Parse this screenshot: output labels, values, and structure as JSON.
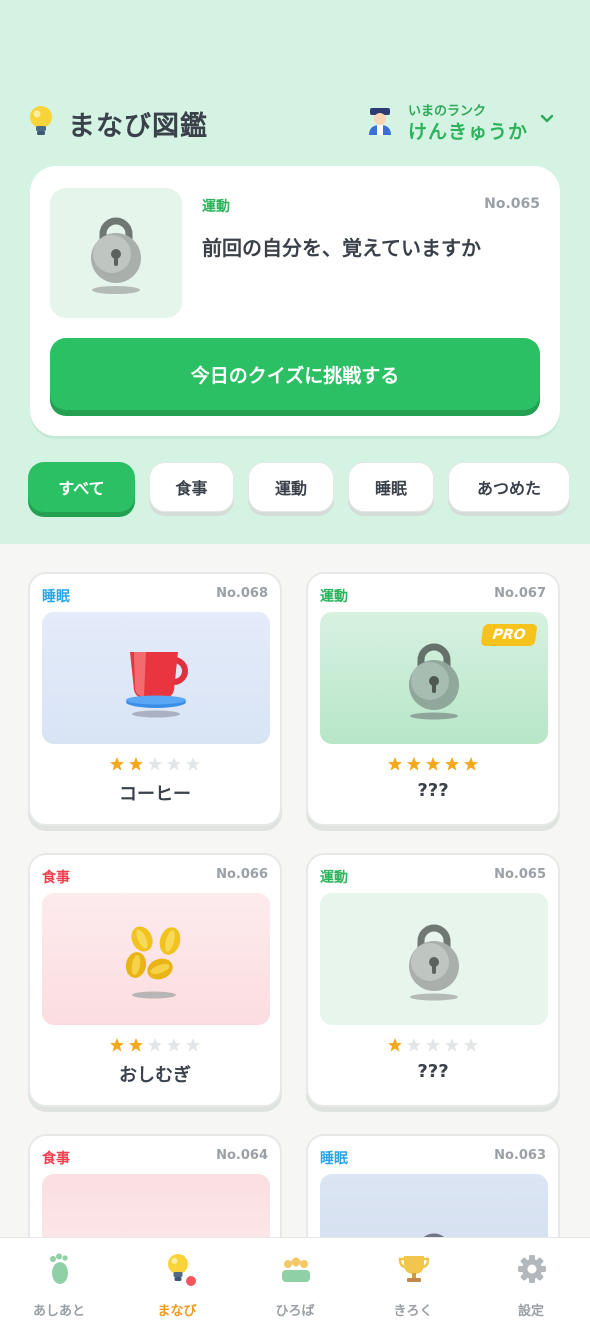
{
  "header": {
    "title": "まなび図鑑",
    "logo_icon": "lightbulb-icon",
    "rank_caption": "いまのランク",
    "rank_value": "けんきゅうか",
    "rank_icon": "scientist-avatar-icon",
    "rank_toggle_icon": "chevron-down-icon"
  },
  "featured": {
    "category": "運動",
    "number": "No.065",
    "title": "前回の自分を、覚えていますか",
    "thumb_icon": "lock-icon",
    "cta_label": "今日のクイズに挑戦する"
  },
  "filters": [
    "すべて",
    "食事",
    "運動",
    "睡眠",
    "あつめた"
  ],
  "active_filter": "すべて",
  "cards": [
    {
      "category": "睡眠",
      "category_color": "#2aa5e8",
      "number": "No.068",
      "name": "コーヒー",
      "rating": 2,
      "icon": "coffee-cup-icon",
      "pro": false,
      "locked": false
    },
    {
      "category": "運動",
      "category_color": "#2cb35c",
      "number": "No.067",
      "name": "???",
      "rating": 5,
      "icon": "lock-icon",
      "pro": true,
      "pro_label": "PRO",
      "locked": true
    },
    {
      "category": "食事",
      "category_color": "#f0404f",
      "number": "No.066",
      "name": "おしむぎ",
      "rating": 2,
      "icon": "barley-grains-icon",
      "pro": false,
      "locked": false
    },
    {
      "category": "運動",
      "category_color": "#2cb35c",
      "number": "No.065",
      "name": "???",
      "rating": 1,
      "icon": "lock-icon",
      "pro": false,
      "locked": true
    },
    {
      "category": "食事",
      "category_color": "#f0404f",
      "number": "No.064",
      "name": "",
      "rating": 0,
      "icon": "food-icon",
      "pro": false,
      "locked": false
    },
    {
      "category": "睡眠",
      "category_color": "#2aa5e8",
      "number": "No.063",
      "name": "",
      "rating": 0,
      "icon": "lock-icon",
      "pro": false,
      "locked": true
    }
  ],
  "nav": [
    {
      "label": "あしあと",
      "icon": "footprint-icon",
      "active": false
    },
    {
      "label": "まなび",
      "icon": "lightbulb-icon",
      "active": true
    },
    {
      "label": "ひろば",
      "icon": "people-icon",
      "active": false
    },
    {
      "label": "きろく",
      "icon": "trophy-icon",
      "active": false
    },
    {
      "label": "設定",
      "icon": "gear-icon",
      "active": false
    }
  ],
  "colors": {
    "primary": "#2bc064",
    "background_top": "#d4f3e2",
    "star_on": "#f4a91c",
    "star_off": "#e3e6e8",
    "nav_active": "#ef9a1e"
  }
}
